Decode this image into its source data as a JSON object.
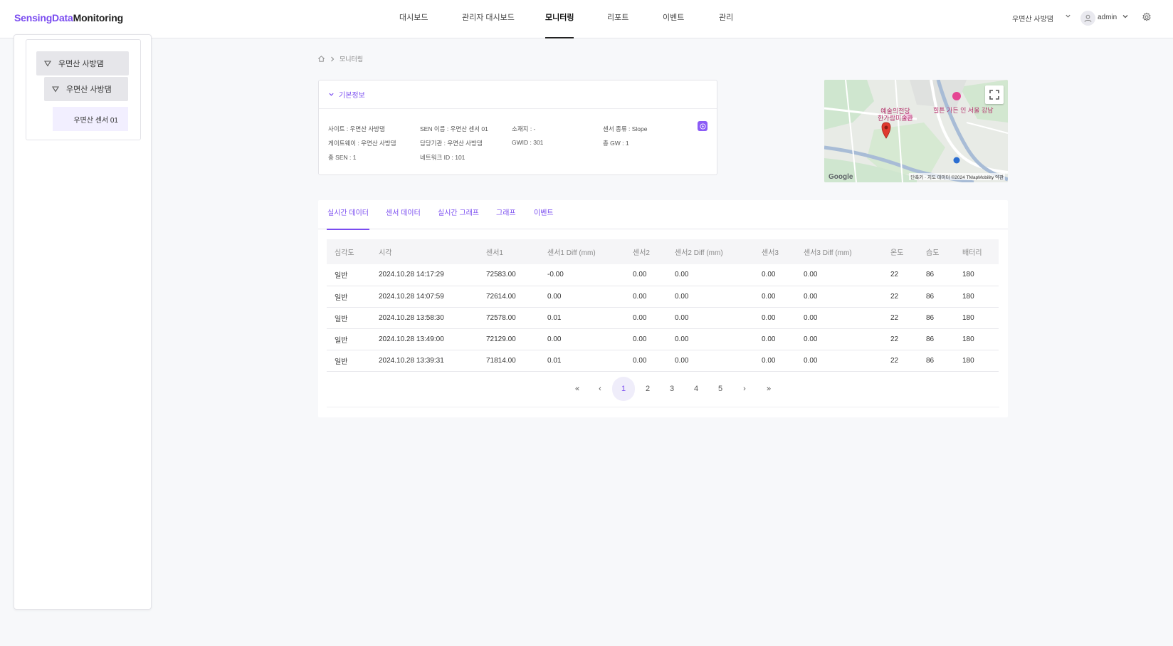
{
  "header": {
    "logo_part1": "SensingData",
    "logo_part2": "Monitoring",
    "nav": [
      "대시보드",
      "관리자 대시보드",
      "모니터링",
      "리포트",
      "이벤트",
      "관리"
    ],
    "active_nav": "모니터링",
    "site": "우면산 사방댐",
    "user": "admin"
  },
  "sidebar": {
    "tree": [
      {
        "label": "우면산 사방댐",
        "level": 0
      },
      {
        "label": "우면산 사방댐",
        "level": 1
      },
      {
        "label": "우면산 센서 01",
        "level": 2
      }
    ]
  },
  "breadcrumb": {
    "current": "모니터링"
  },
  "info": {
    "title": "기본정보",
    "site": "사이트 : 우면산 사방댐",
    "gateway": "게이트웨이 : 우면산 사방댐",
    "sen_total": "총 SEN : 1",
    "sen_name": "SEN 이름 : 우면산 센서 01",
    "manager": "담당기관 : 우면산 사방댐",
    "network_id": "네트워크 ID : 101",
    "location": "소재지 : -",
    "gwid": "GWID : 301",
    "sensor_type": "센서 종류 : Slope",
    "gw_total": "총 GW : 1"
  },
  "map": {
    "labels": {
      "hall": "예술의전당\n한가람미술관",
      "hotel": "힐튼 가든 인 서울 강남"
    },
    "shortcut": "단축키",
    "attribution": "지도 데이터 ©2024 TMapMobility",
    "terms": "약관",
    "google": "Google"
  },
  "tabs": [
    "실시간 데이터",
    "센서 데이터",
    "실시간 그래프",
    "그래프",
    "이벤트"
  ],
  "table": {
    "headers": [
      "심각도",
      "시각",
      "센서1",
      "센서1 Diff (mm)",
      "센서2",
      "센서2 Diff (mm)",
      "센서3",
      "센서3 Diff (mm)",
      "온도",
      "습도",
      "배터리"
    ],
    "rows": [
      [
        "일반",
        "2024.10.28 14:17:29",
        "72583.00",
        "-0.00",
        "0.00",
        "0.00",
        "0.00",
        "0.00",
        "22",
        "86",
        "180"
      ],
      [
        "일반",
        "2024.10.28 14:07:59",
        "72614.00",
        "0.00",
        "0.00",
        "0.00",
        "0.00",
        "0.00",
        "22",
        "86",
        "180"
      ],
      [
        "일반",
        "2024.10.28 13:58:30",
        "72578.00",
        "0.01",
        "0.00",
        "0.00",
        "0.00",
        "0.00",
        "22",
        "86",
        "180"
      ],
      [
        "일반",
        "2024.10.28 13:49:00",
        "72129.00",
        "0.00",
        "0.00",
        "0.00",
        "0.00",
        "0.00",
        "22",
        "86",
        "180"
      ],
      [
        "일반",
        "2024.10.28 13:39:31",
        "71814.00",
        "0.01",
        "0.00",
        "0.00",
        "0.00",
        "0.00",
        "22",
        "86",
        "180"
      ]
    ]
  },
  "pagination": {
    "first": "«",
    "prev": "‹",
    "pages": [
      "1",
      "2",
      "3",
      "4",
      "5"
    ],
    "current": "1",
    "next": "›",
    "last": "»"
  },
  "colors": {
    "accent": "#7a4cf0",
    "map_pin": "#e03a2f"
  }
}
